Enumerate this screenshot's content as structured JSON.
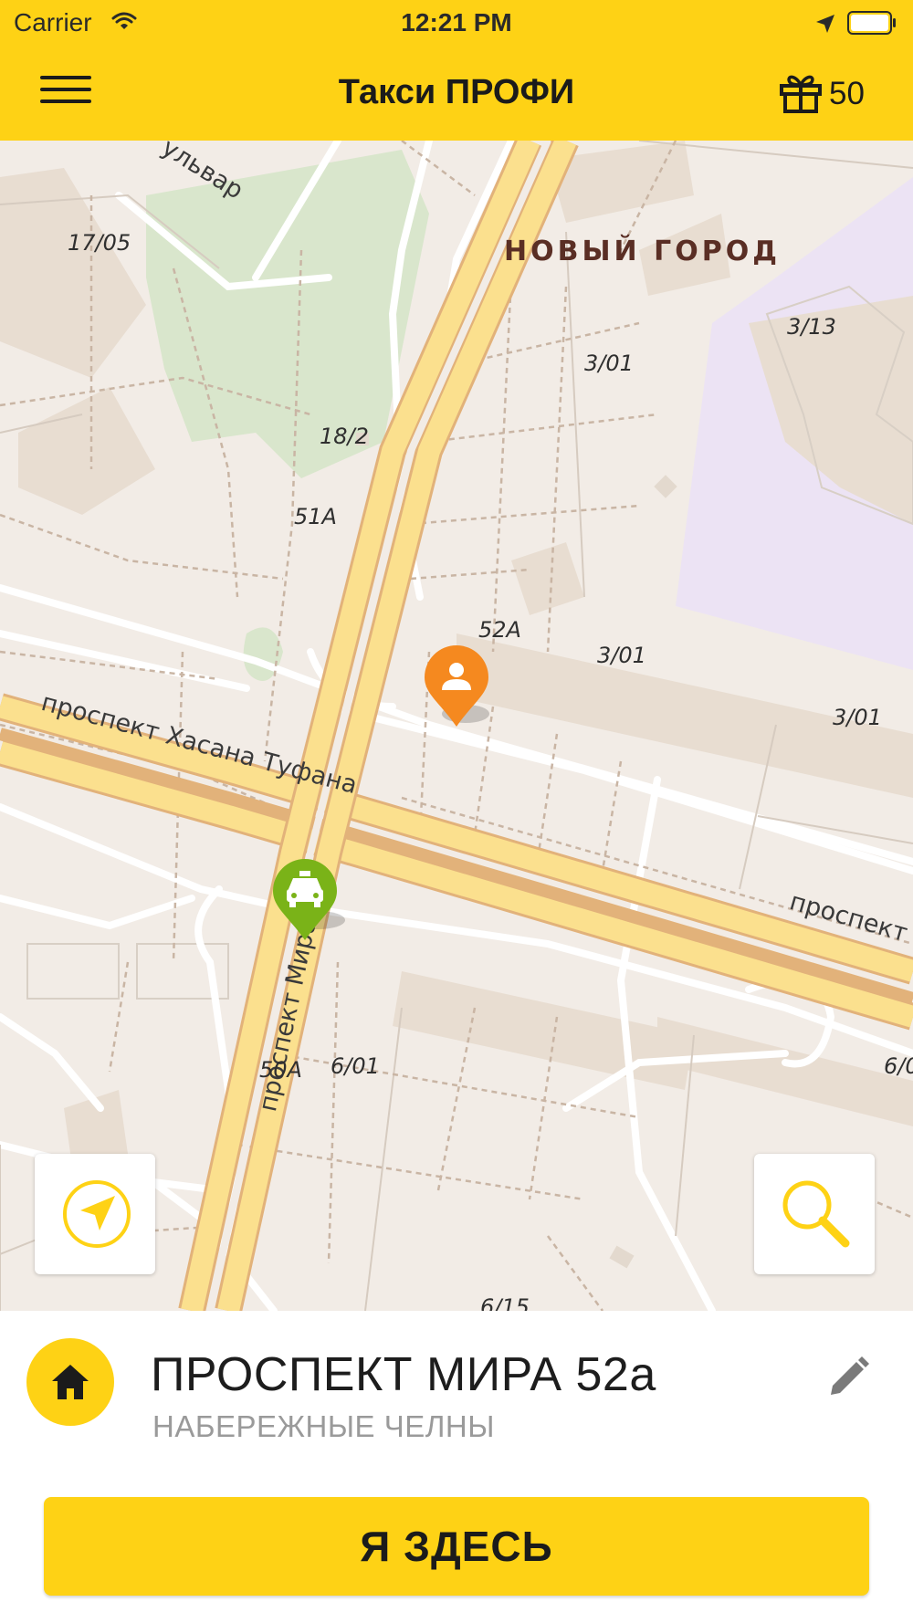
{
  "status_bar": {
    "carrier": "Carrier",
    "time": "12:21 PM"
  },
  "header": {
    "title": "Такси ПРОФИ",
    "bonus_count": "50",
    "menu_icon": "hamburger-menu-icon",
    "bonus_icon": "gift-icon"
  },
  "map": {
    "district": "НОВЫЙ ГОРОД",
    "streets": [
      "ульвар",
      "проспект Хасана Туфана",
      "проспект Мира",
      "проспект"
    ],
    "house_numbers": [
      "17/05",
      "3/13",
      "3/01",
      "18/2",
      "51А",
      "52А",
      "3/01",
      "3/01",
      "50А",
      "6/01",
      "6/0",
      "6/15"
    ],
    "pins": {
      "user": "person-pin-icon",
      "taxi": "taxi-pin-icon"
    },
    "controls": {
      "locate": "navigation-arrow-icon",
      "search": "search-icon"
    }
  },
  "address_panel": {
    "address": "ПРОСПЕКТ МИРА 52а",
    "city": "НАБЕРЕЖНЫЕ ЧЕЛНЫ",
    "home_icon": "home-icon",
    "edit_icon": "pencil-icon"
  },
  "action_button": {
    "label": "Я ЗДЕСЬ"
  },
  "colors": {
    "accent": "#fed215",
    "user_pin": "#f5891f",
    "taxi_pin": "#7ab318",
    "map_background": "#f2ece6"
  }
}
